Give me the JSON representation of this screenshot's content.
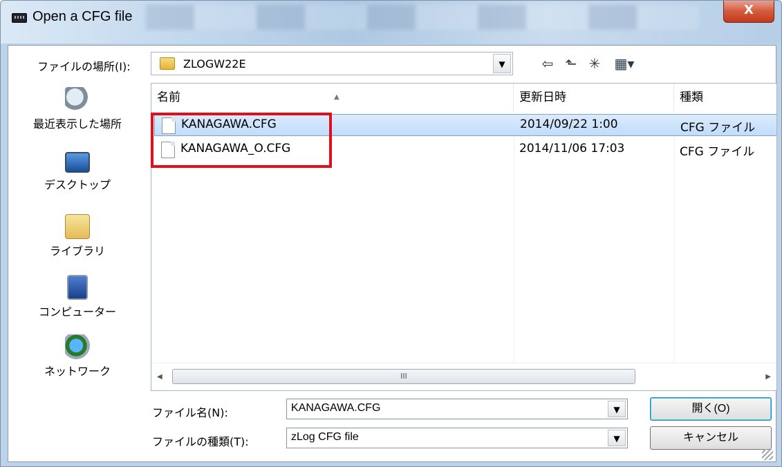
{
  "window": {
    "title": "Open a CFG file",
    "close_label": "X"
  },
  "lookin": {
    "label": "ファイルの場所(I):",
    "value": "ZLOGW22E"
  },
  "places": [
    {
      "label": "最近表示した場所",
      "icon": "recent-places-icon"
    },
    {
      "label": "デスクトップ",
      "icon": "desktop-icon"
    },
    {
      "label": "ライブラリ",
      "icon": "libraries-icon"
    },
    {
      "label": "コンピューター",
      "icon": "computer-icon"
    },
    {
      "label": "ネットワーク",
      "icon": "network-icon"
    }
  ],
  "columns": {
    "name": "名前",
    "date": "更新日時",
    "type": "種類"
  },
  "files": [
    {
      "name": "KANAGAWA.CFG",
      "date": "2014/09/22 1:00",
      "type": "CFG ファイル",
      "selected": true
    },
    {
      "name": "KANAGAWA_O.CFG",
      "date": "2014/11/06 17:03",
      "type": "CFG ファイル",
      "selected": false
    }
  ],
  "scroll": {
    "thumb_glyph": "III"
  },
  "filename": {
    "label": "ファイル名(N):",
    "value": "KANAGAWA.CFG"
  },
  "filetype": {
    "label": "ファイルの種類(T):",
    "value": "zLog CFG file"
  },
  "buttons": {
    "open": "開く(O)",
    "cancel": "キャンセル"
  },
  "colors": {
    "highlight": "#e0101a",
    "selection": "#c1dcfc",
    "close": "#c23a1c"
  }
}
